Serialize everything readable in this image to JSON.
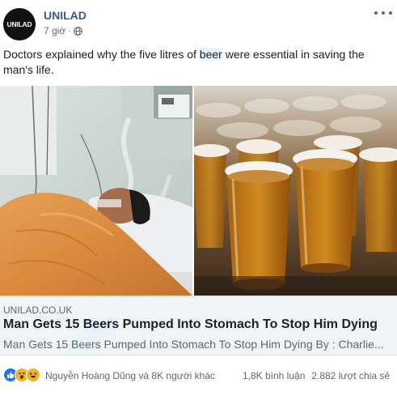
{
  "post": {
    "page_name": "UNILAD",
    "avatar_logo": "UNILAD",
    "time": "7 giờ",
    "dot": "·",
    "caption_before": "Doctors explained why the five litres of ",
    "caption_highlight": "beer",
    "caption_after": " were essential in saving the man's life."
  },
  "link": {
    "domain": "UNILAD.CO.UK",
    "title_before": "Man Gets 15 ",
    "title_highlight": "Beers",
    "title_after": " Pumped Into Stomach To Stop Him Dying",
    "desc_before": "Man Gets 15 ",
    "desc_highlight": "Beers",
    "desc_after": " Pumped Into Stomach To Stop Him Dying By : Charlie..."
  },
  "reactions": {
    "icons": [
      "like-icon",
      "wow-icon",
      "haha-icon"
    ],
    "names": "Nguyễn Hoàng Dũng và 8K người khác",
    "comments": "1,8K bình luận",
    "shares": "2.882 lượt chia sẻ"
  },
  "colors": {
    "page_name": "#385898",
    "like": "#1877f2",
    "emoji": "#f7b125",
    "highlight": "#e7f3ff"
  }
}
